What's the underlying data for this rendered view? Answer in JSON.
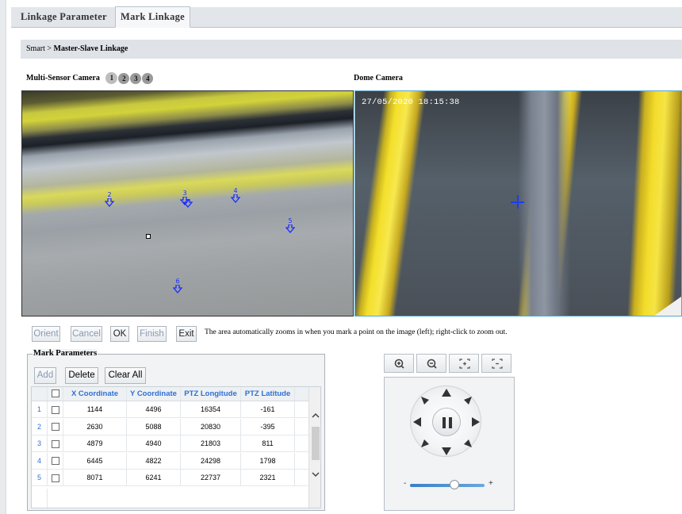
{
  "tabs": [
    {
      "label": "Linkage Parameter",
      "active": false
    },
    {
      "label": "Mark Linkage",
      "active": true
    }
  ],
  "breadcrumb": {
    "root": "Smart",
    "separator": ">",
    "current": "Master-Slave Linkage"
  },
  "left_header": {
    "title": "Multi-Sensor Camera",
    "sensors": [
      "1",
      "2",
      "3",
      "4"
    ],
    "selected": "1"
  },
  "right_header": {
    "title": "Dome Camera"
  },
  "dome_video": {
    "timestamp": "27/05/2020 18:15:38"
  },
  "markers": [
    "2",
    "3",
    "3",
    "4",
    "5",
    "6"
  ],
  "buttons": {
    "orient": "Orient",
    "cancel": "Cancel",
    "ok": "OK",
    "finish": "Finish",
    "exit": "Exit"
  },
  "hint": "The area automatically zooms in when you mark a point on the image (left); right-click to zoom out.",
  "mark_params": {
    "title": "Mark Parameters",
    "add": "Add",
    "delete": "Delete",
    "clear_all": "Clear All",
    "columns": [
      "X Coordinate",
      "Y Coordinate",
      "PTZ Longitude",
      "PTZ Latitude"
    ],
    "rows": [
      {
        "n": "1",
        "x": "1144",
        "y": "4496",
        "lon": "16354",
        "lat": "-161"
      },
      {
        "n": "2",
        "x": "2630",
        "y": "5088",
        "lon": "20830",
        "lat": "-395"
      },
      {
        "n": "3",
        "x": "4879",
        "y": "4940",
        "lon": "21803",
        "lat": "811"
      },
      {
        "n": "4",
        "x": "6445",
        "y": "4822",
        "lon": "24298",
        "lat": "1798"
      },
      {
        "n": "5",
        "x": "8071",
        "y": "6241",
        "lon": "22737",
        "lat": "2321"
      }
    ]
  },
  "ptz": {
    "zoom_minus": "-",
    "zoom_plus": "+",
    "zoom_level": 0.6
  },
  "colors": {
    "marker": "#1b2dff",
    "accent_link": "#2f6fd4",
    "crosshair": "#1a3cff"
  }
}
